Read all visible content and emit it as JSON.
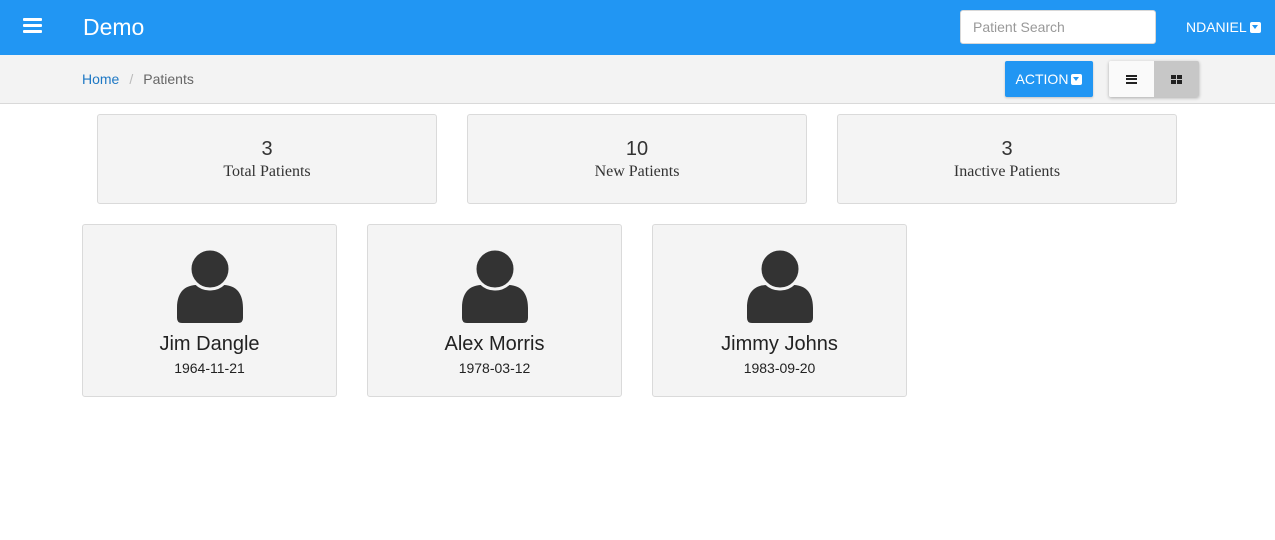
{
  "navbar": {
    "brand": "Demo",
    "menu_icon": "hamburger-menu-icon",
    "search_placeholder": "Patient Search",
    "user": "NDANIEL",
    "color": "#2196f3"
  },
  "breadcrumb": {
    "home": "Home",
    "separator": "/",
    "current": "Patients"
  },
  "toolbar": {
    "action_label": "ACTION",
    "view_modes": [
      "list-view-icon",
      "grid-view-icon"
    ],
    "active_view": "grid"
  },
  "stats": [
    {
      "value": "3",
      "label": "Total Patients"
    },
    {
      "value": "10",
      "label": "New Patients"
    },
    {
      "value": "3",
      "label": "Inactive Patients"
    }
  ],
  "patients": [
    {
      "name": "Jim Dangle",
      "dob": "1964-11-21",
      "icon": "user-avatar-icon"
    },
    {
      "name": "Alex Morris",
      "dob": "1978-03-12",
      "icon": "user-avatar-icon"
    },
    {
      "name": "Jimmy Johns",
      "dob": "1983-09-20",
      "icon": "user-avatar-icon"
    }
  ]
}
